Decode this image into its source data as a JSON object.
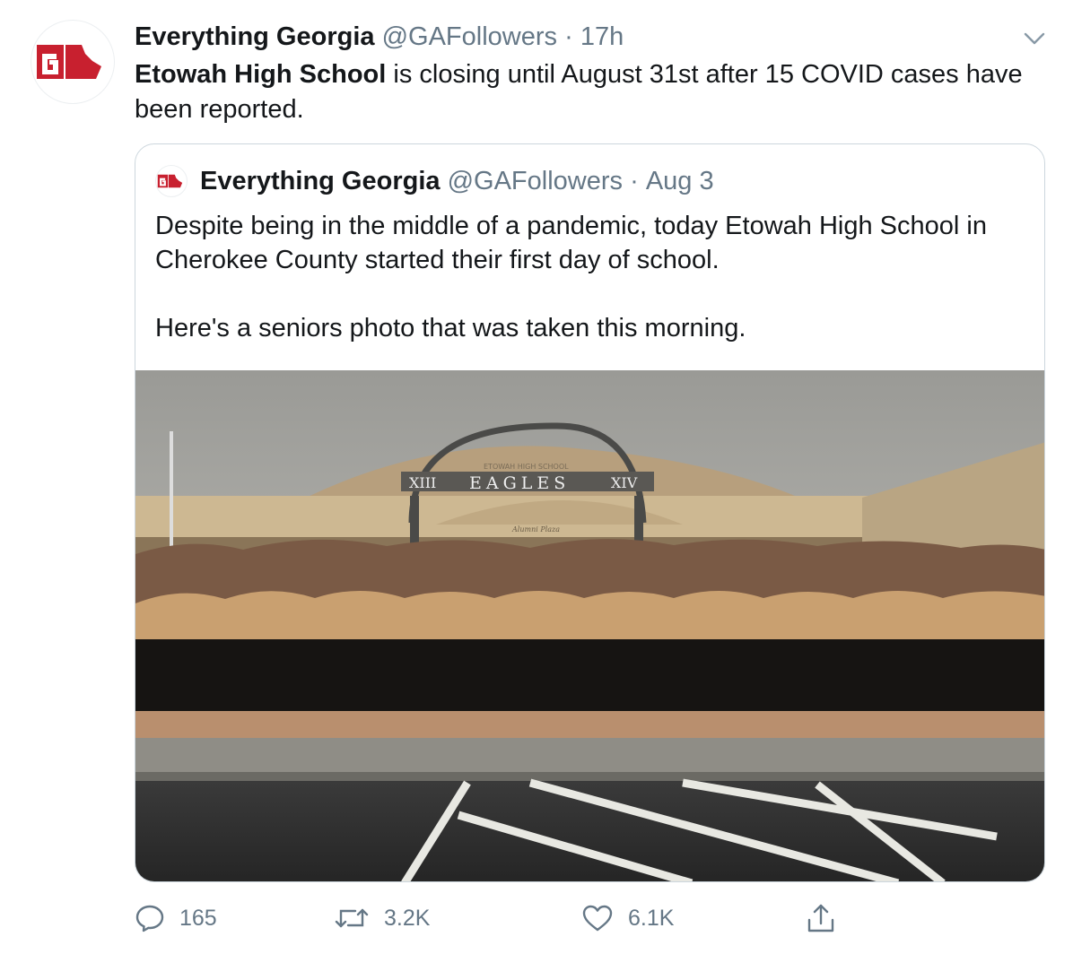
{
  "tweet": {
    "author_name": "Everything Georgia",
    "author_handle": "@GAFollowers",
    "separator": "·",
    "time": "17h",
    "text_bold": "Etowah High School",
    "text_rest": " is closing until August 31st after 15 COVID cases have been reported."
  },
  "quoted": {
    "author_name": "Everything Georgia",
    "author_handle": "@GAFollowers",
    "separator": "·",
    "time": "Aug 3",
    "paragraph1": "Despite being in the middle of a pandemic, today Etowah High School in Cherokee County started their first day of school.",
    "paragraph2": "Here's a seniors photo that was taken this morning.",
    "photo_sign": {
      "main": "EAGLES",
      "left": "XIII",
      "right": "XIV",
      "arch": "ETOWAH HIGH SCHOOL",
      "plaza": "Alumni Plaza"
    }
  },
  "actions": {
    "reply_count": "165",
    "retweet_count": "3.2K",
    "like_count": "6.1K"
  },
  "colors": {
    "logo_red": "#c8202f",
    "secondary_text": "#657786",
    "border": "#ccd6dd"
  },
  "icons": [
    "georgia-logo-icon",
    "chevron-down-icon",
    "reply-icon",
    "retweet-icon",
    "like-icon",
    "share-icon"
  ]
}
